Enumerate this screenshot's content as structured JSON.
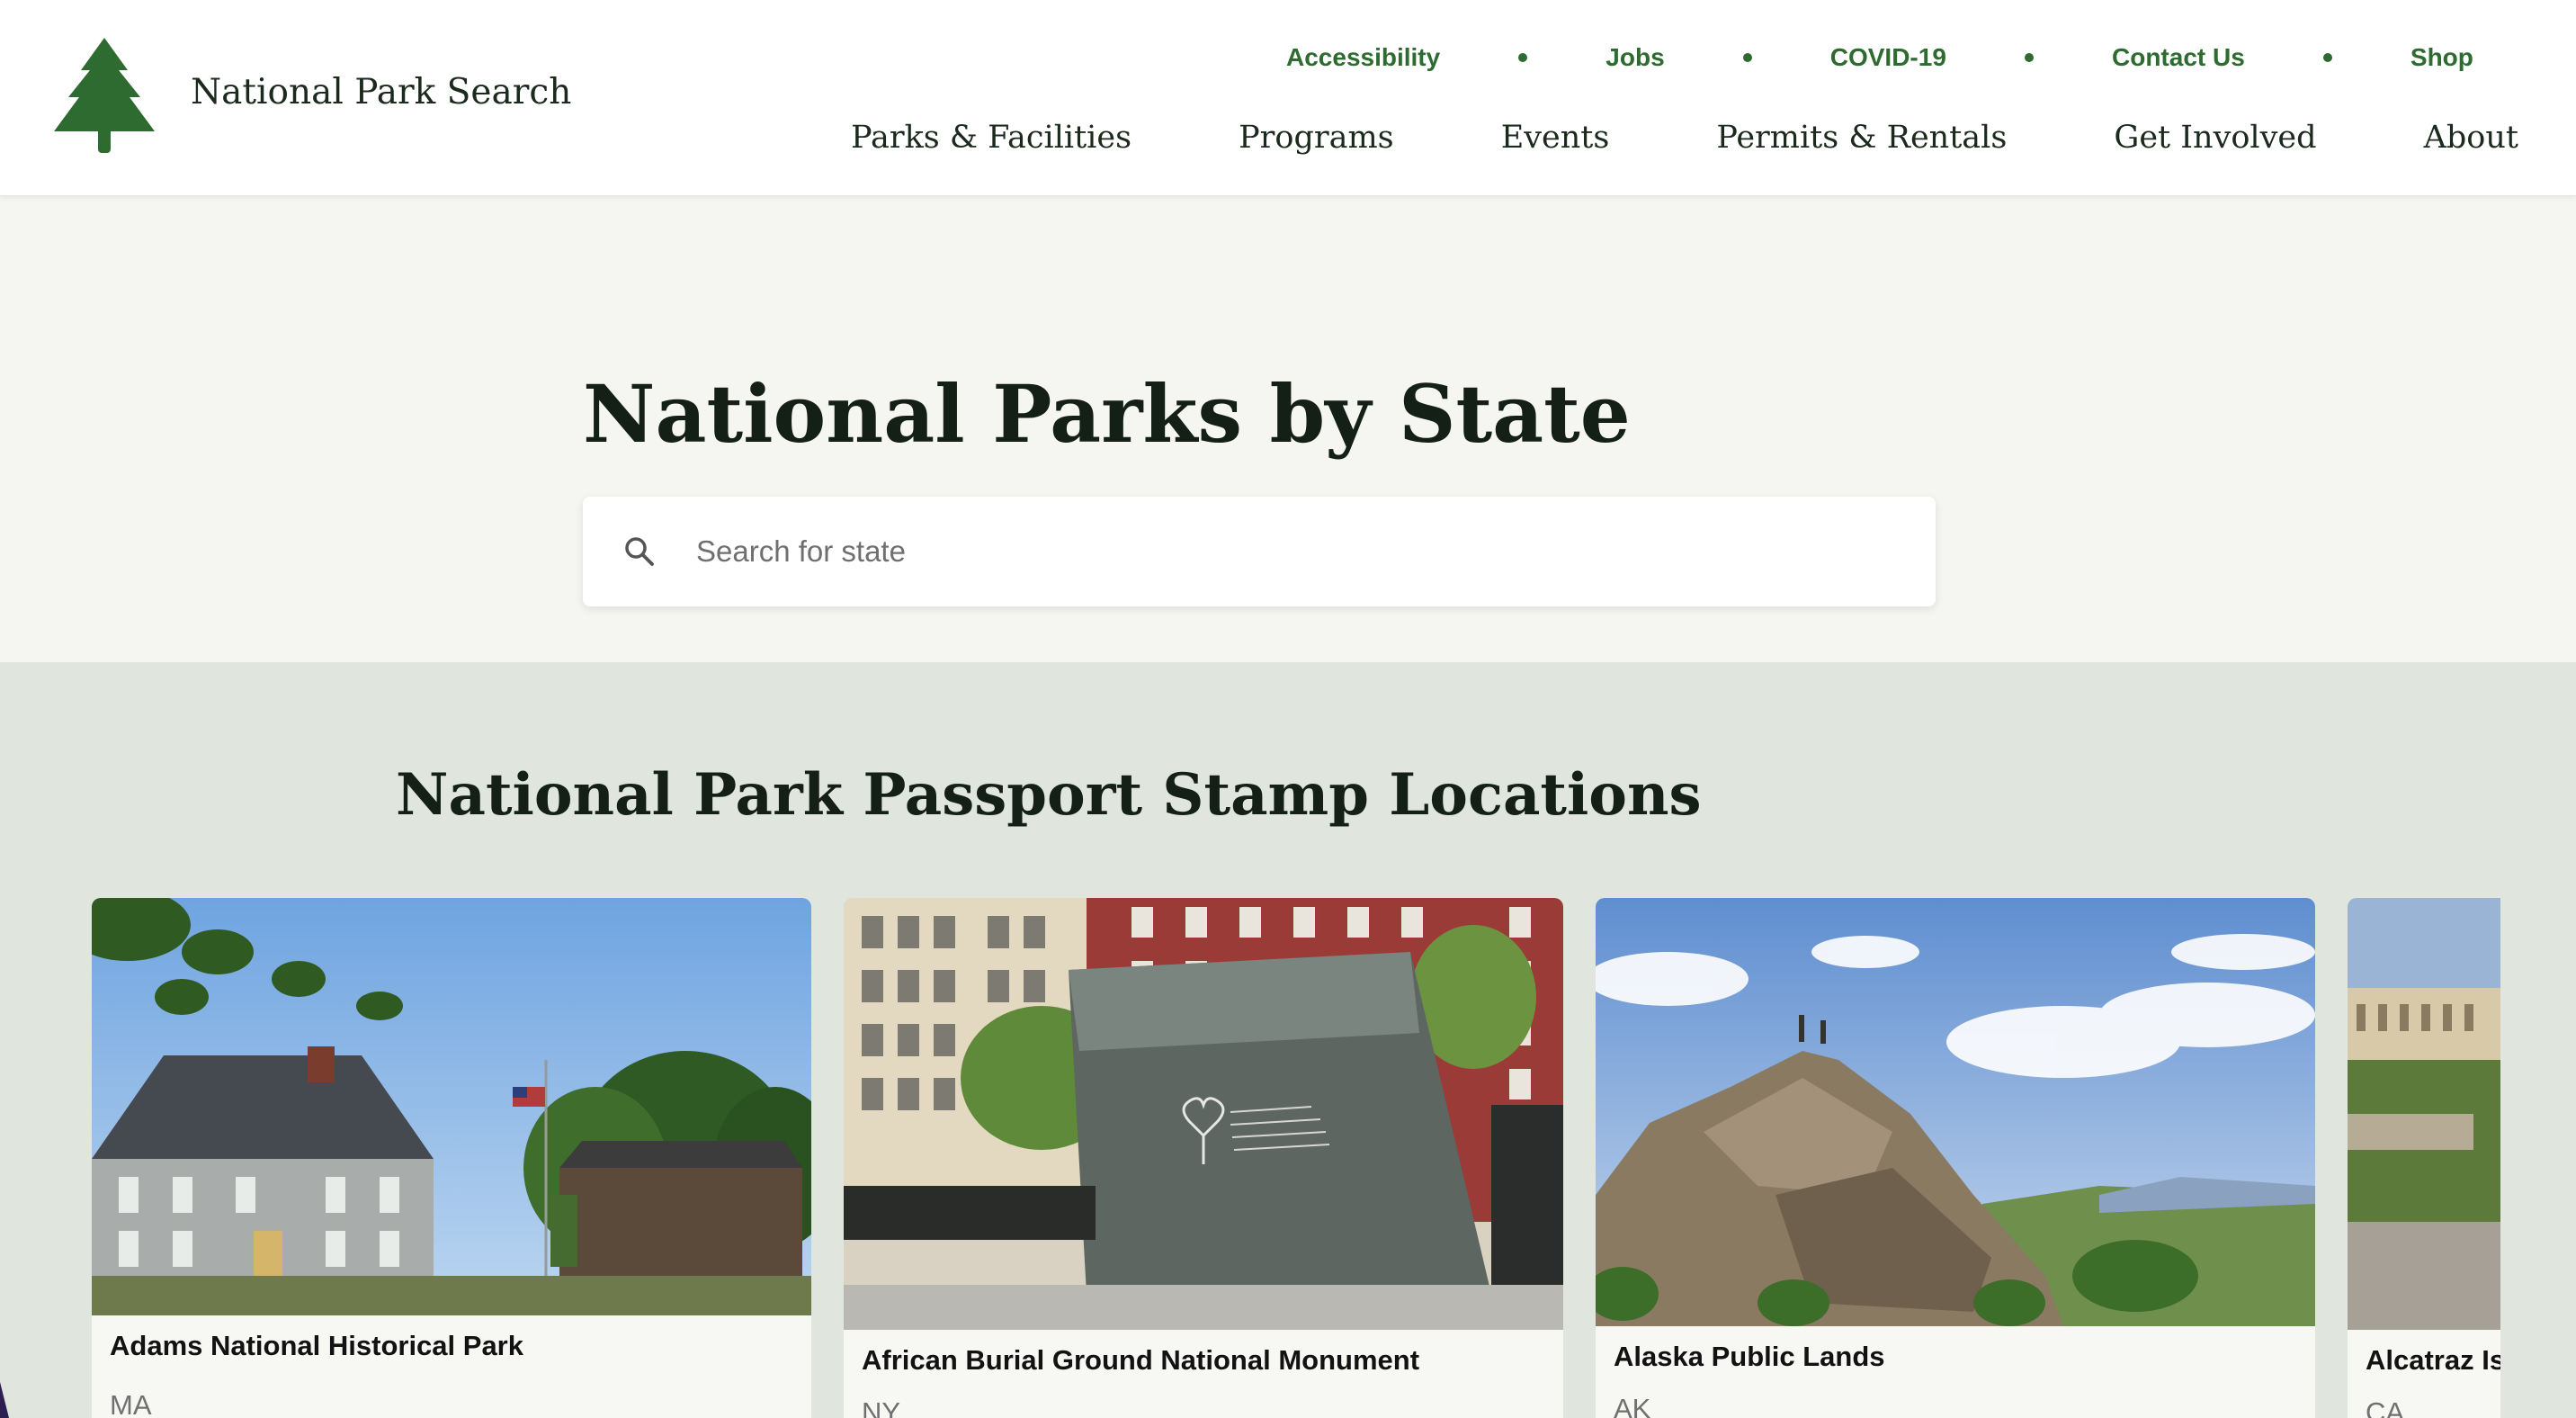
{
  "site": {
    "title": "National Park Search",
    "logo_icon": "pine-tree-icon",
    "brand_color": "#2e6b30"
  },
  "util_nav": {
    "items": [
      "Accessibility",
      "Jobs",
      "COVID-19",
      "Contact Us",
      "Shop"
    ]
  },
  "main_nav": {
    "items": [
      "Parks & Facilities",
      "Programs",
      "Events",
      "Permits & Rentals",
      "Get Involved",
      "About"
    ]
  },
  "hero": {
    "title": "National Parks by State",
    "search_placeholder": "Search for state",
    "search_value": ""
  },
  "stamps": {
    "title": "National Park Passport Stamp Locations",
    "cards": [
      {
        "name": "Adams National Historical Park",
        "state": "MA"
      },
      {
        "name": "African Burial Ground National Monument",
        "state": "NY"
      },
      {
        "name": "Alaska Public Lands",
        "state": "AK"
      },
      {
        "name": "Alcatraz Is",
        "state": "CA"
      }
    ]
  }
}
